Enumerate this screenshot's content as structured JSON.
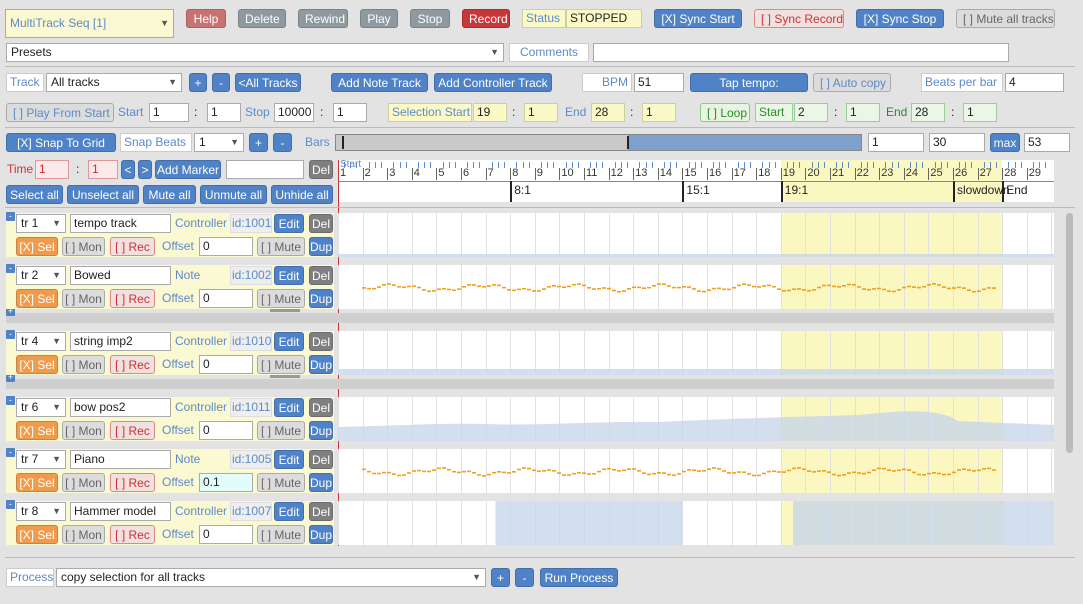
{
  "header": {
    "window_select": "MultiTrack Seq [1]",
    "help": "Help",
    "delete": "Delete",
    "rewind": "Rewind",
    "play": "Play",
    "stop": "Stop",
    "record": "Record",
    "status_label": "Status",
    "status_value": "STOPPED",
    "sync_start": "[X] Sync Start",
    "sync_record": "[ ] Sync Record",
    "sync_stop": "[X] Sync Stop",
    "mute_all": "[ ] Mute all tracks"
  },
  "presets": {
    "value": "Presets",
    "comments_label": "Comments",
    "comments_value": ""
  },
  "trackbar": {
    "track_label": "Track",
    "track_select": "All tracks",
    "plus": "+",
    "minus": "-",
    "all_tracks": "<All Tracks",
    "add_note": "Add Note Track",
    "add_controller": "Add Controller Track",
    "bpm_label": "BPM",
    "bpm_value": "51",
    "tap_tempo": "Tap tempo:",
    "auto_copy": "[ ] Auto copy",
    "beats_label": "Beats per bar",
    "beats_value": "4"
  },
  "playbar": {
    "play_from_start": "[ ] Play From Start",
    "start_label": "Start",
    "start_bar": "1",
    "start_beat": "1",
    "stop_label": "Stop",
    "stop_bar": "10000",
    "stop_beat": "1",
    "sel_start_label": "Selection Start",
    "sel_start_bar": "19",
    "sel_start_beat": "1",
    "end_label": "End",
    "end_bar": "28",
    "end_beat": "1",
    "loop": "[ ] Loop",
    "loop_start_label": "Start",
    "loop_start_bar": "2",
    "loop_start_beat": "1",
    "loop_end_label": "End",
    "loop_end_bar": "28",
    "loop_end_beat": "1"
  },
  "snapbar": {
    "snap_grid": "[X] Snap To Grid",
    "snap_beats_label": "Snap Beats",
    "snap_beats_value": "1",
    "plus": "+",
    "minus": "-",
    "bars_label": "Bars",
    "bars_from": "1",
    "bars_to": "30",
    "max": "max",
    "max_value": "53"
  },
  "timebar": {
    "time_label": "Time",
    "time_bar": "1",
    "time_beat": "1",
    "prev": "<",
    "next": ">",
    "add_marker": "Add Marker",
    "marker_name": "",
    "del": "Del",
    "ruler_start": "Start",
    "bar_numbers": [
      "1",
      "2",
      "3",
      "4",
      "5",
      "6",
      "7",
      "8",
      "9",
      "10",
      "11",
      "12",
      "13",
      "14",
      "15",
      "16",
      "17",
      "18",
      "19",
      "20",
      "21",
      "22",
      "23",
      "24",
      "25",
      "26",
      "27",
      "28",
      "29"
    ],
    "markers": [
      "8:1",
      "15:1",
      "19:1",
      "slowdown",
      "End"
    ]
  },
  "selectbar": {
    "select_all": "Select all",
    "unselect_all": "Unselect all",
    "mute_all": "Mute all",
    "unmute_all": "Unmute all",
    "unhide_all": "Unhide all"
  },
  "tracks": [
    {
      "id_select": "tr 1",
      "name": "tempo track",
      "type": "Controller",
      "tid": "id:1001",
      "offset": "0",
      "sel": "[X] Sel",
      "mon": "[ ] Mon",
      "rec": "[ ] Rec",
      "mute": "[ ] Mute",
      "edit": "Edit",
      "del": "Del",
      "dup": "Dup",
      "offset_label": "Offset"
    },
    {
      "id_select": "tr 2",
      "name": "Bowed",
      "type": "Note",
      "tid": "id:1002",
      "offset": "0",
      "sel": "[X] Sel",
      "mon": "[ ] Mon",
      "rec": "[ ] Rec",
      "mute": "[ ] Mute",
      "edit": "Edit",
      "del": "Del",
      "dup": "Dup",
      "offset_label": "Offset"
    },
    {
      "id_select": "tr 4",
      "name": "string imp2",
      "type": "Controller",
      "tid": "id:1010",
      "offset": "0",
      "sel": "[X] Sel",
      "mon": "[ ] Mon",
      "rec": "[ ] Rec",
      "mute": "[ ] Mute",
      "edit": "Edit",
      "del": "Del",
      "dup": "Dup",
      "offset_label": "Offset"
    },
    {
      "id_select": "tr 6",
      "name": "bow pos2",
      "type": "Controller",
      "tid": "id:1011",
      "offset": "0",
      "sel": "[X] Sel",
      "mon": "[ ] Mon",
      "rec": "[ ] Rec",
      "mute": "[ ] Mute",
      "edit": "Edit",
      "del": "Del",
      "dup": "Dup",
      "offset_label": "Offset"
    },
    {
      "id_select": "tr 7",
      "name": "Piano",
      "type": "Note",
      "tid": "id:1005",
      "offset": "0.1",
      "sel": "[X] Sel",
      "mon": "[ ] Mon",
      "rec": "[ ] Rec",
      "mute": "[ ] Mute",
      "edit": "Edit",
      "del": "Del",
      "dup": "Dup",
      "offset_label": "Offset"
    },
    {
      "id_select": "tr 8",
      "name": "Hammer model",
      "type": "Controller",
      "tid": "id:1007",
      "offset": "0",
      "sel": "[X] Sel",
      "mon": "[ ] Mon",
      "rec": "[ ] Rec",
      "mute": "[ ] Mute",
      "edit": "Edit",
      "del": "Del",
      "dup": "Dup",
      "offset_label": "Offset"
    }
  ],
  "process": {
    "label": "Process",
    "value": "copy selection for all tracks",
    "plus": "+",
    "minus": "-",
    "run": "Run Process"
  },
  "colors": {
    "accent": "#4f82c6",
    "selection": "#fbf7c0",
    "note": "#f0a020",
    "controller_fill": "#c8d6ea"
  }
}
